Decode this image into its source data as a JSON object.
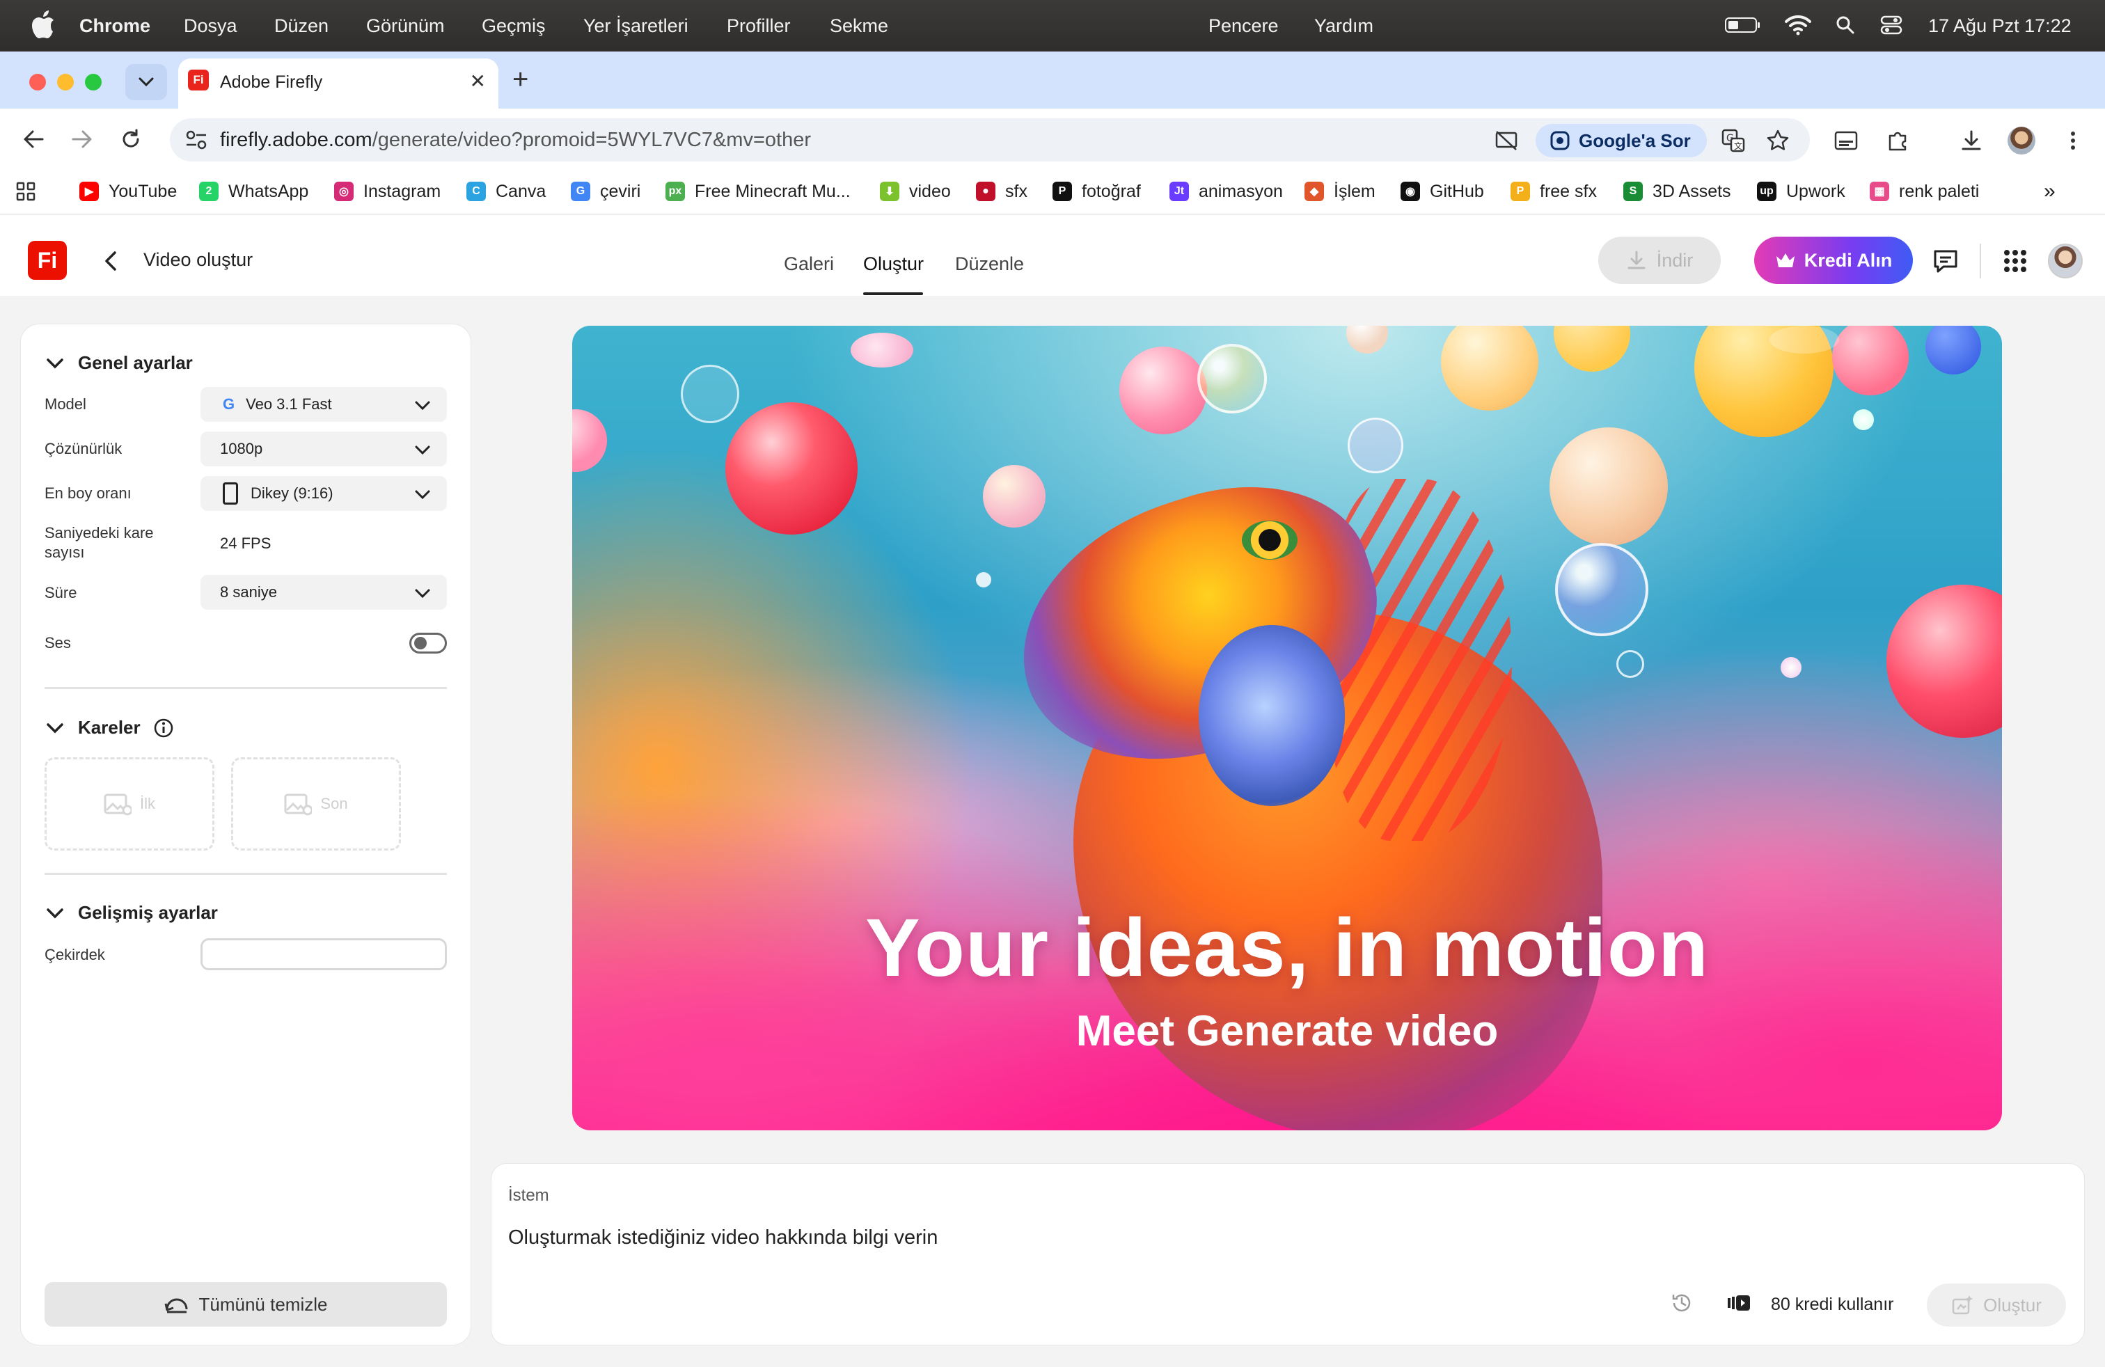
{
  "menubar": {
    "app": "Chrome",
    "items": [
      "Dosya",
      "Düzen",
      "Görünüm",
      "Geçmiş",
      "Yer İşaretleri",
      "Profiller",
      "Sekme",
      "Pencere",
      "Yardım"
    ],
    "datetime": "17 Ağu Pzt  17:22"
  },
  "tab": {
    "title": "Adobe Firefly",
    "favicon": "Fi"
  },
  "address": {
    "host": "firefly.adobe.com",
    "path": "/generate/video?promoid=5WYL7VC7&mv=other"
  },
  "ask_google": "Google'a Sor",
  "bookmarks": [
    {
      "label": "YouTube",
      "color": "#ff0000",
      "glyph": "▶"
    },
    {
      "label": "WhatsApp",
      "color": "#25d366",
      "glyph": "2"
    },
    {
      "label": "Instagram",
      "color": "#d62976",
      "glyph": "◎"
    },
    {
      "label": "Canva",
      "color": "#2aa3e0",
      "glyph": "C"
    },
    {
      "label": "çeviri",
      "color": "#4285f4",
      "glyph": "G"
    },
    {
      "label": "Free Minecraft Mu...",
      "color": "#4caf50",
      "glyph": "px"
    },
    {
      "label": "video",
      "color": "#7cc22c",
      "glyph": "⬇"
    },
    {
      "label": "sfx",
      "color": "#c0102a",
      "glyph": "●"
    },
    {
      "label": "fotoğraf",
      "color": "#111111",
      "glyph": "P"
    },
    {
      "label": "animasyon",
      "color": "#6a3cff",
      "glyph": "Jt"
    },
    {
      "label": "İşlem",
      "color": "#e0562a",
      "glyph": "◆"
    },
    {
      "label": "GitHub",
      "color": "#111111",
      "glyph": "◉"
    },
    {
      "label": "free sfx",
      "color": "#f3b01a",
      "glyph": "P"
    },
    {
      "label": "3D Assets",
      "color": "#1a8c35",
      "glyph": "S"
    },
    {
      "label": "Upwork",
      "color": "#111111",
      "glyph": "up"
    },
    {
      "label": "renk paleti",
      "color": "#e84b8a",
      "glyph": "▦"
    }
  ],
  "header": {
    "title": "Video oluştur",
    "tabs": [
      "Galeri",
      "Oluştur",
      "Düzenle"
    ],
    "active_tab": "Oluştur",
    "download": "İndir",
    "get_credits": "Kredi Alın"
  },
  "settings": {
    "general_title": "Genel ayarlar",
    "model_label": "Model",
    "model_value": "Veo 3.1 Fast",
    "resolution_label": "Çözünürlük",
    "resolution_value": "1080p",
    "aspect_label": "En boy oranı",
    "aspect_value": "Dikey (9:16)",
    "fps_label": "Saniyedeki kare sayısı",
    "fps_value": "24 FPS",
    "duration_label": "Süre",
    "duration_value": "8 saniye",
    "audio_label": "Ses",
    "audio_on": false,
    "frames_title": "Kareler",
    "frame_first": "İlk",
    "frame_last": "Son",
    "advanced_title": "Gelişmiş ayarlar",
    "seed_label": "Çekirdek",
    "seed_value": "",
    "clear_all": "Tümünü temizle"
  },
  "hero": {
    "title": "Your ideas, in motion",
    "subtitle": "Meet Generate video"
  },
  "prompt": {
    "label": "İstem",
    "placeholder": "Oluşturmak istediğiniz video hakkında bilgi verin",
    "credits": "80 kredi kullanır",
    "generate": "Oluştur"
  },
  "colors": {
    "brand": "#eb1000",
    "credit_gradient_start": "#e33bb5",
    "credit_gradient_end": "#3f5bf5",
    "tabstrip": "#d3e3fd"
  }
}
